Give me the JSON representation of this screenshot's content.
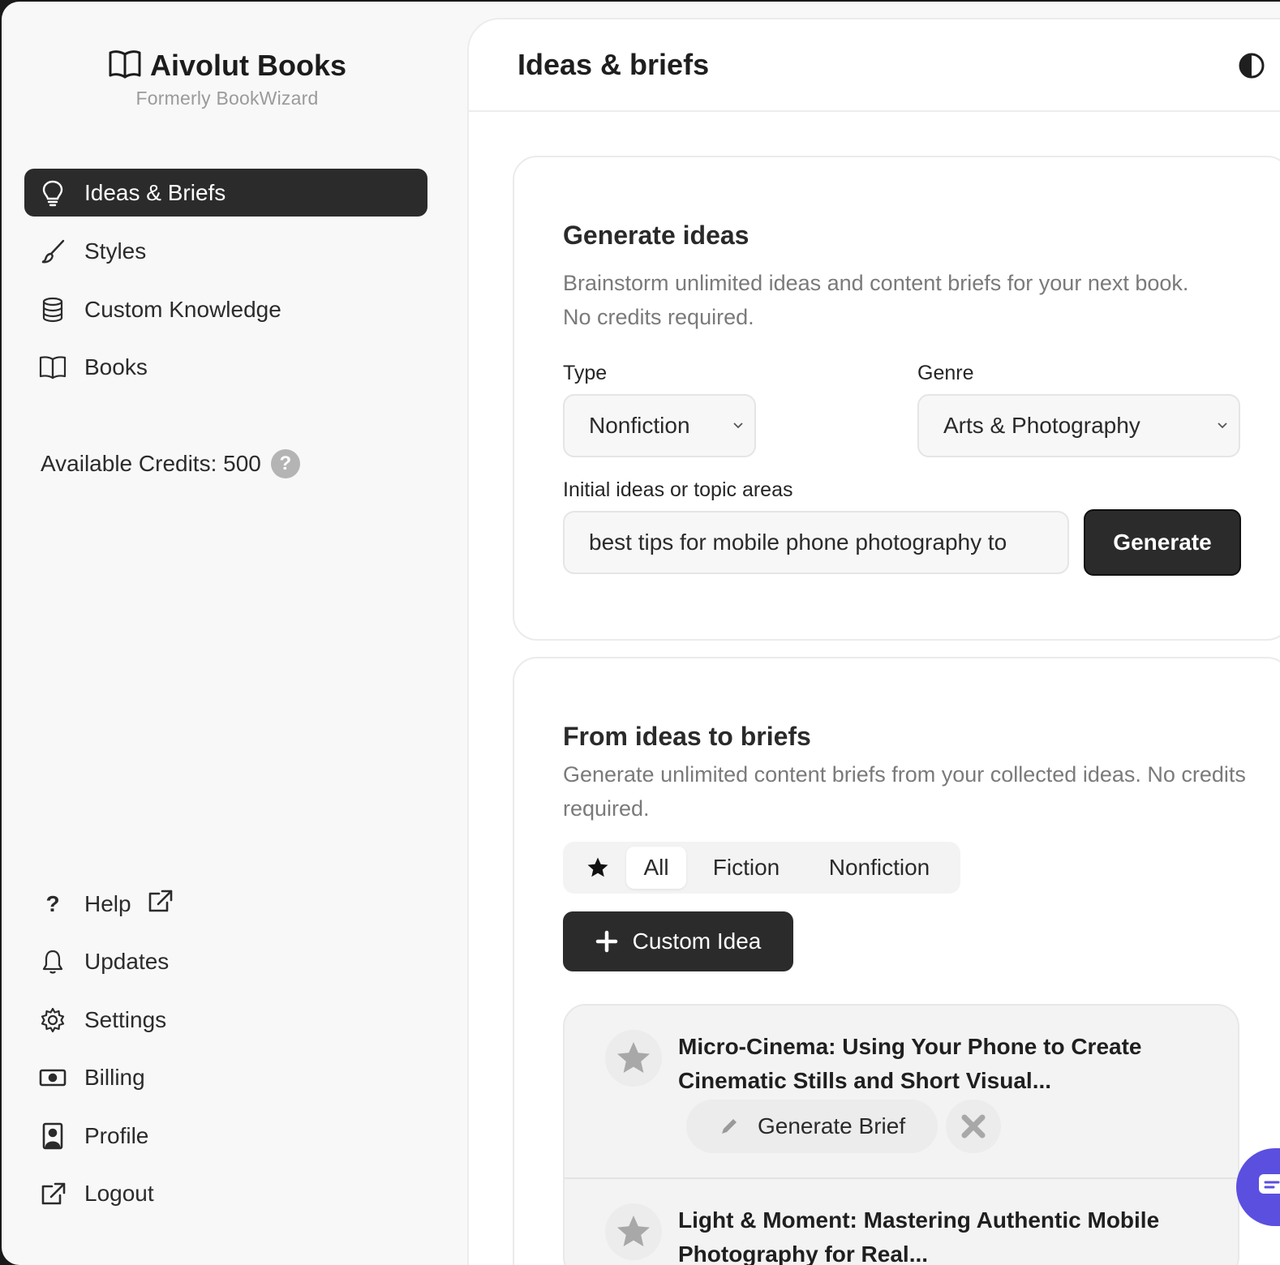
{
  "brand": {
    "title": "Aivolut Books",
    "subtitle": "Formerly BookWizard"
  },
  "sidebar": {
    "nav": [
      {
        "label": "Ideas & Briefs",
        "icon": "lightbulb-icon",
        "active": true
      },
      {
        "label": "Styles",
        "icon": "brush-icon",
        "active": false
      },
      {
        "label": "Custom Knowledge",
        "icon": "database-icon",
        "active": false
      },
      {
        "label": "Books",
        "icon": "book-icon",
        "active": false
      }
    ],
    "credits_label": "Available Credits: 500",
    "bottom": [
      {
        "label": "Help",
        "icon": "question-icon"
      },
      {
        "label": "Updates",
        "icon": "bell-icon"
      },
      {
        "label": "Settings",
        "icon": "gear-icon"
      },
      {
        "label": "Billing",
        "icon": "money-icon"
      },
      {
        "label": "Profile",
        "icon": "profile-icon"
      },
      {
        "label": "Logout",
        "icon": "logout-icon"
      }
    ]
  },
  "header": {
    "title": "Ideas & briefs"
  },
  "generate": {
    "title": "Generate ideas",
    "description": "Brainstorm unlimited ideas and content briefs for your next book. No credits required.",
    "type_label": "Type",
    "type_value": "Nonfiction",
    "genre_label": "Genre",
    "genre_value": "Arts & Photography",
    "topic_label": "Initial ideas or topic areas",
    "topic_value": "best tips for mobile phone photography to",
    "button": "Generate"
  },
  "briefs": {
    "title": "From ideas to briefs",
    "description": "Generate unlimited content briefs from your collected ideas. No credits required.",
    "filters": [
      "All",
      "Fiction",
      "Nonfiction"
    ],
    "selected_filter": "All",
    "custom_button": "Custom Idea",
    "ideas": [
      {
        "title": "Micro-Cinema: Using Your Phone to Create Cinematic Stills and Short Visual...",
        "action": "Generate Brief"
      },
      {
        "title": "Light & Moment: Mastering Authentic Mobile Photography for Real..."
      }
    ]
  }
}
